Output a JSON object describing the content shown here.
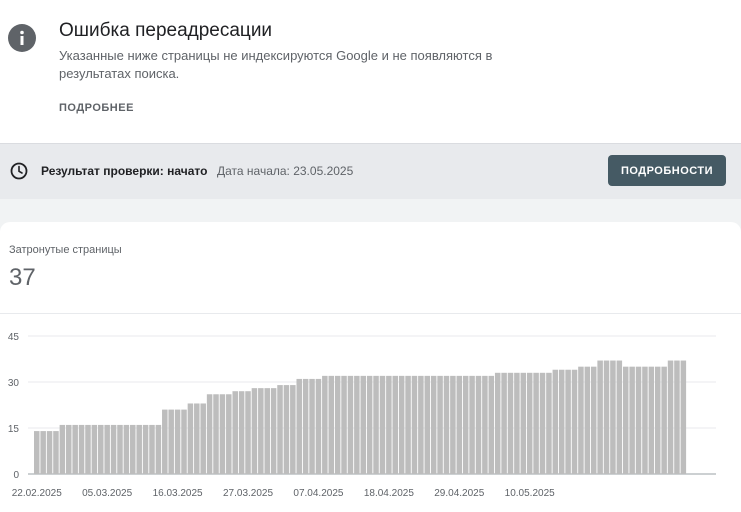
{
  "issue": {
    "title": "Ошибка переадресации",
    "description": "Указанные ниже страницы не индексируются Google и не появляются в результатах поиска.",
    "more_link": "ПОДРОБНЕЕ",
    "icon": "info-icon"
  },
  "validation": {
    "status": "Результат проверки: начато",
    "start_date": "Дата начала: 23.05.2025",
    "details_button": "ПОДРОБНОСТИ",
    "icon": "clock-icon"
  },
  "metric": {
    "label": "Затронутые страницы",
    "value": "37"
  },
  "colors": {
    "bar": "#bdbdbd",
    "button_bg": "#455a64",
    "validation_bg": "#e8eaed"
  },
  "chart_data": {
    "type": "bar",
    "title": "",
    "xlabel": "",
    "ylabel": "",
    "ylim": [
      0,
      45
    ],
    "yticks": [
      0,
      15,
      30,
      45
    ],
    "grid": true,
    "xtick_labels": [
      "22.02.2025",
      "05.03.2025",
      "16.03.2025",
      "27.03.2025",
      "07.04.2025",
      "18.04.2025",
      "29.04.2025",
      "10.05.2025"
    ],
    "xtick_indices": [
      0,
      11,
      22,
      33,
      44,
      55,
      66,
      77
    ],
    "values": [
      14,
      14,
      14,
      14,
      16,
      16,
      16,
      16,
      16,
      16,
      16,
      16,
      16,
      16,
      16,
      16,
      16,
      16,
      16,
      16,
      21,
      21,
      21,
      21,
      23,
      23,
      23,
      26,
      26,
      26,
      26,
      27,
      27,
      27,
      28,
      28,
      28,
      28,
      29,
      29,
      29,
      31,
      31,
      31,
      31,
      32,
      32,
      32,
      32,
      32,
      32,
      32,
      32,
      32,
      32,
      32,
      32,
      32,
      32,
      32,
      32,
      32,
      32,
      32,
      32,
      32,
      32,
      32,
      32,
      32,
      32,
      32,
      33,
      33,
      33,
      33,
      33,
      33,
      33,
      33,
      33,
      34,
      34,
      34,
      34,
      35,
      35,
      35,
      37,
      37,
      37,
      37,
      35,
      35,
      35,
      35,
      35,
      35,
      35,
      37,
      37,
      37
    ]
  }
}
